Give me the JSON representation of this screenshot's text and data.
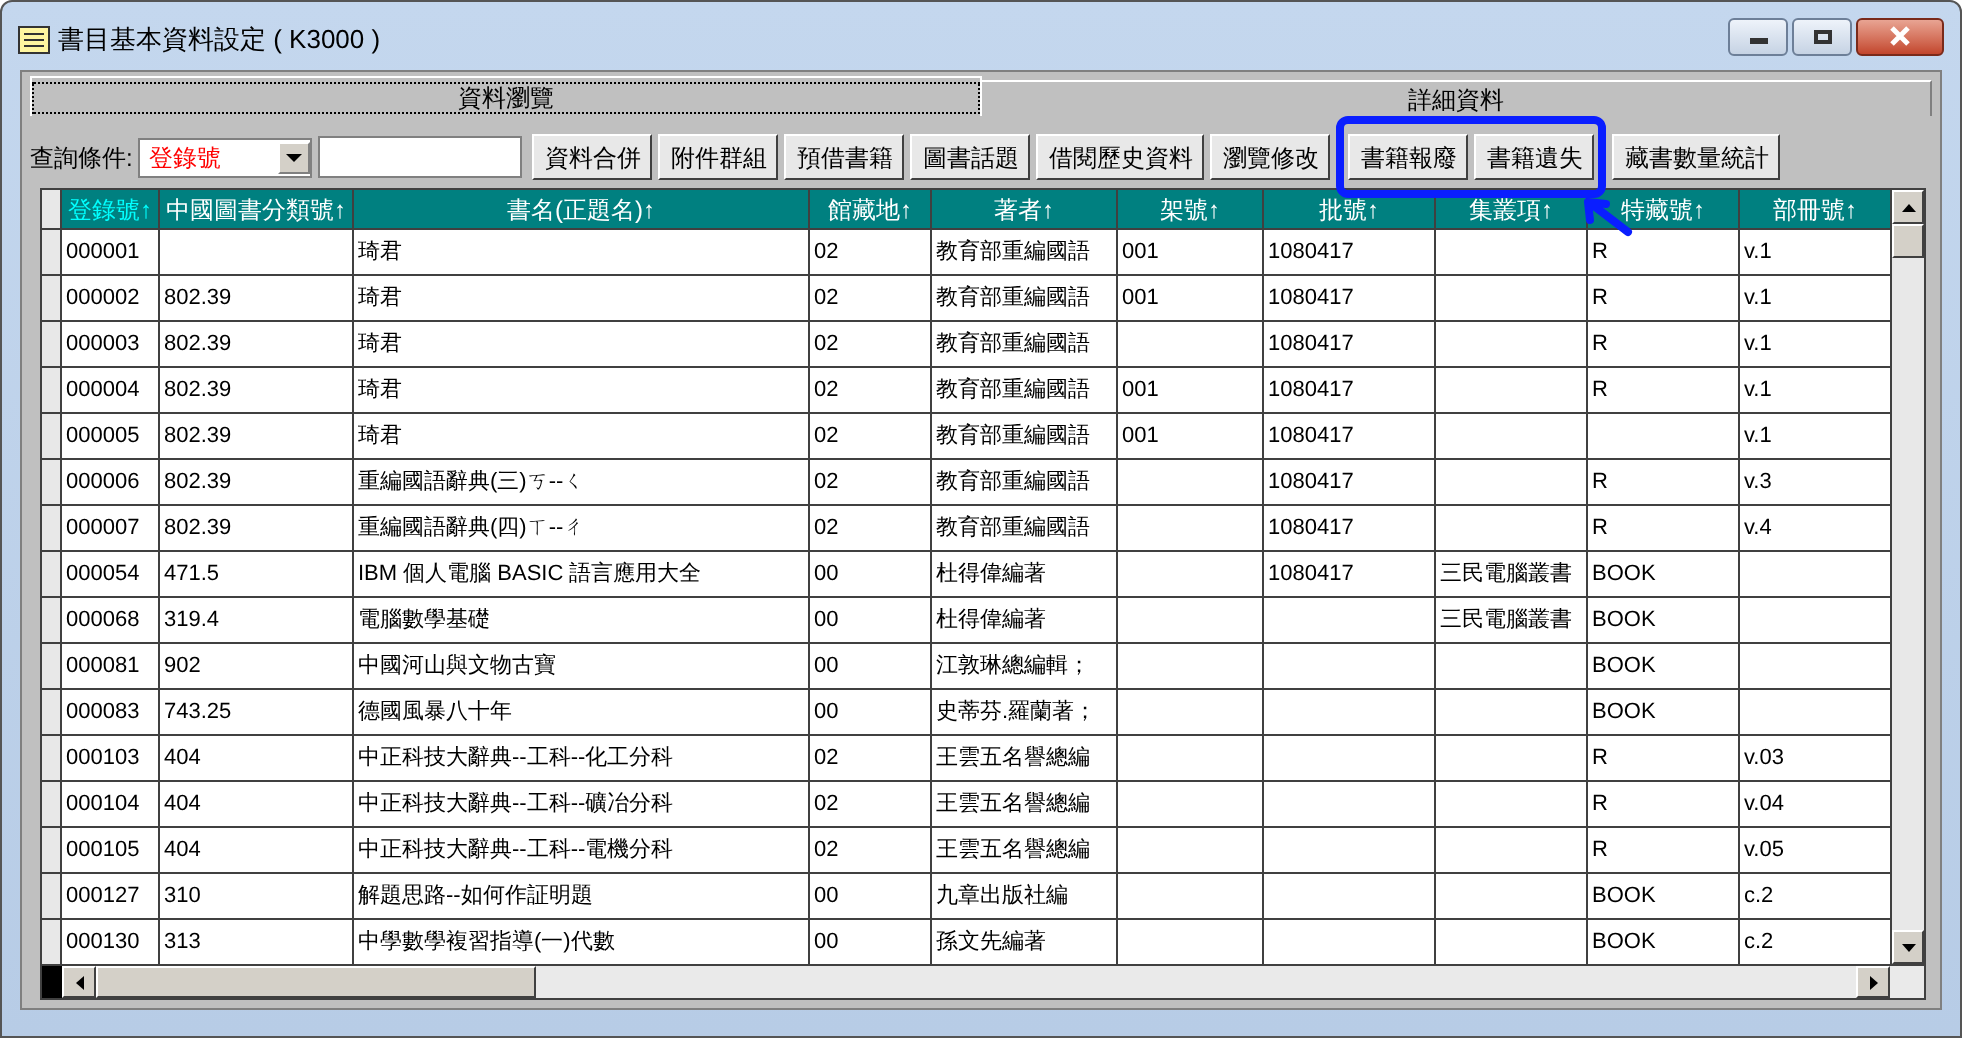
{
  "window": {
    "title": "書目基本資料設定 ( K3000 )"
  },
  "tabs": [
    {
      "label": "資料瀏覽",
      "selected": true
    },
    {
      "label": "詳細資料",
      "selected": false
    }
  ],
  "query": {
    "label": "查詢條件:",
    "field": "登錄號"
  },
  "buttons": [
    "資料合併",
    "附件群組",
    "預借書籍",
    "圖書話題",
    "借閱歷史資料",
    "瀏覽修改",
    "書籍報廢",
    "書籍遺失",
    "藏書數量統計"
  ],
  "table": {
    "columns": [
      {
        "label": "登錄號↑",
        "sorted": true
      },
      {
        "label": "中國圖書分類號↑",
        "sorted": false
      },
      {
        "label": "書名(正題名)↑",
        "sorted": false
      },
      {
        "label": "館藏地↑",
        "sorted": false
      },
      {
        "label": "著者↑",
        "sorted": false
      },
      {
        "label": "架號↑",
        "sorted": false
      },
      {
        "label": "批號↑",
        "sorted": false
      },
      {
        "label": "集叢項↑",
        "sorted": false
      },
      {
        "label": "特藏號↑",
        "sorted": false
      },
      {
        "label": "部冊號↑",
        "sorted": false
      }
    ],
    "rows": [
      [
        "000001",
        null,
        "琦君",
        "02",
        "教育部重編國語",
        "001",
        "1080417",
        null,
        "R",
        "v.1"
      ],
      [
        "000002",
        "802.39",
        "琦君",
        "02",
        "教育部重編國語",
        "001",
        "1080417",
        null,
        "R",
        "v.1"
      ],
      [
        "000003",
        "802.39",
        "琦君",
        "02",
        "教育部重編國語",
        null,
        "1080417",
        null,
        "R",
        "v.1"
      ],
      [
        "000004",
        "802.39",
        "琦君",
        "02",
        "教育部重編國語",
        "001",
        "1080417",
        null,
        "R",
        "v.1"
      ],
      [
        "000005",
        "802.39",
        "琦君",
        "02",
        "教育部重編國語",
        "001",
        "1080417",
        null,
        null,
        "v.1"
      ],
      [
        "000006",
        "802.39",
        "重編國語辭典(三)ㄎ--ㄑ",
        "02",
        "教育部重編國語",
        null,
        "1080417",
        null,
        "R",
        "v.3"
      ],
      [
        "000007",
        "802.39",
        "重編國語辭典(四)ㄒ--ㄔ",
        "02",
        "教育部重編國語",
        null,
        "1080417",
        null,
        "R",
        "v.4"
      ],
      [
        "000054",
        "471.5",
        "IBM 個人電腦 BASIC 語言應用大全",
        "00",
        "杜得偉編著",
        null,
        "1080417",
        "三民電腦叢書",
        "BOOK",
        null
      ],
      [
        "000068",
        "319.4",
        "電腦數學基礎",
        "00",
        "杜得偉編著",
        null,
        null,
        "三民電腦叢書",
        "BOOK",
        null
      ],
      [
        "000081",
        "902",
        "中國河山與文物古寶",
        "00",
        "江敦琳總編輯；",
        null,
        null,
        null,
        "BOOK",
        null
      ],
      [
        "000083",
        "743.25",
        "德國風暴八十年",
        "00",
        "史蒂芬.羅蘭著；",
        null,
        null,
        null,
        "BOOK",
        null
      ],
      [
        "000103",
        "404",
        "中正科技大辭典--工科--化工分科",
        "02",
        "王雲五名譽總編",
        null,
        null,
        null,
        "R",
        "v.03"
      ],
      [
        "000104",
        "404",
        "中正科技大辭典--工科--礦冶分科",
        "02",
        "王雲五名譽總編",
        null,
        null,
        null,
        "R",
        "v.04"
      ],
      [
        "000105",
        "404",
        "中正科技大辭典--工科--電機分科",
        "02",
        "王雲五名譽總編",
        null,
        null,
        null,
        "R",
        "v.05"
      ],
      [
        "000127",
        "310",
        "解題思路--如何作証明題",
        "00",
        "九章出版社編",
        null,
        null,
        null,
        "BOOK",
        "c.2"
      ],
      [
        "000130",
        "313",
        "中學數學複習指導(一)代數",
        "00",
        "孫文先編著",
        null,
        null,
        null,
        "BOOK",
        "c.2"
      ]
    ]
  }
}
